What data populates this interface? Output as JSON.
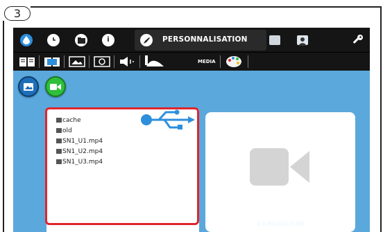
{
  "callout": {
    "step": "3"
  },
  "topbar": {
    "icons": [
      "drop-icon",
      "clock-icon",
      "folder-icon",
      "info-icon",
      "brush-icon",
      "monitor-icon",
      "person-icon",
      "key-icon"
    ],
    "active_tab": "PERSONNALISATION"
  },
  "subbar": {
    "items": [
      "book-icon",
      "book-open-icon",
      "image-icon",
      "screen-icon",
      "speaker-icon",
      "media-icon",
      "palette-icon"
    ],
    "media_label": "MEDIA"
  },
  "media_type_buttons": [
    {
      "name": "images",
      "icon": "image-icon",
      "color": "#1e6fb8"
    },
    {
      "name": "videos",
      "icon": "camera-icon",
      "color": "#2fbf3b"
    }
  ],
  "files": [
    {
      "type": "folder",
      "name": "cache"
    },
    {
      "type": "folder",
      "name": "old"
    },
    {
      "type": "video",
      "name": "SN1_U1.mp4"
    },
    {
      "type": "video",
      "name": "SN1_U2.mp4"
    },
    {
      "type": "video",
      "name": "SN1_U3.mp4"
    }
  ],
  "source": {
    "icon": "usb-icon",
    "color": "#2d8fdc"
  },
  "highlight_color": "#e0242c",
  "preview": {
    "icon": "video-camera-icon"
  },
  "capacity": "0.0 Mb/200.0 MB"
}
